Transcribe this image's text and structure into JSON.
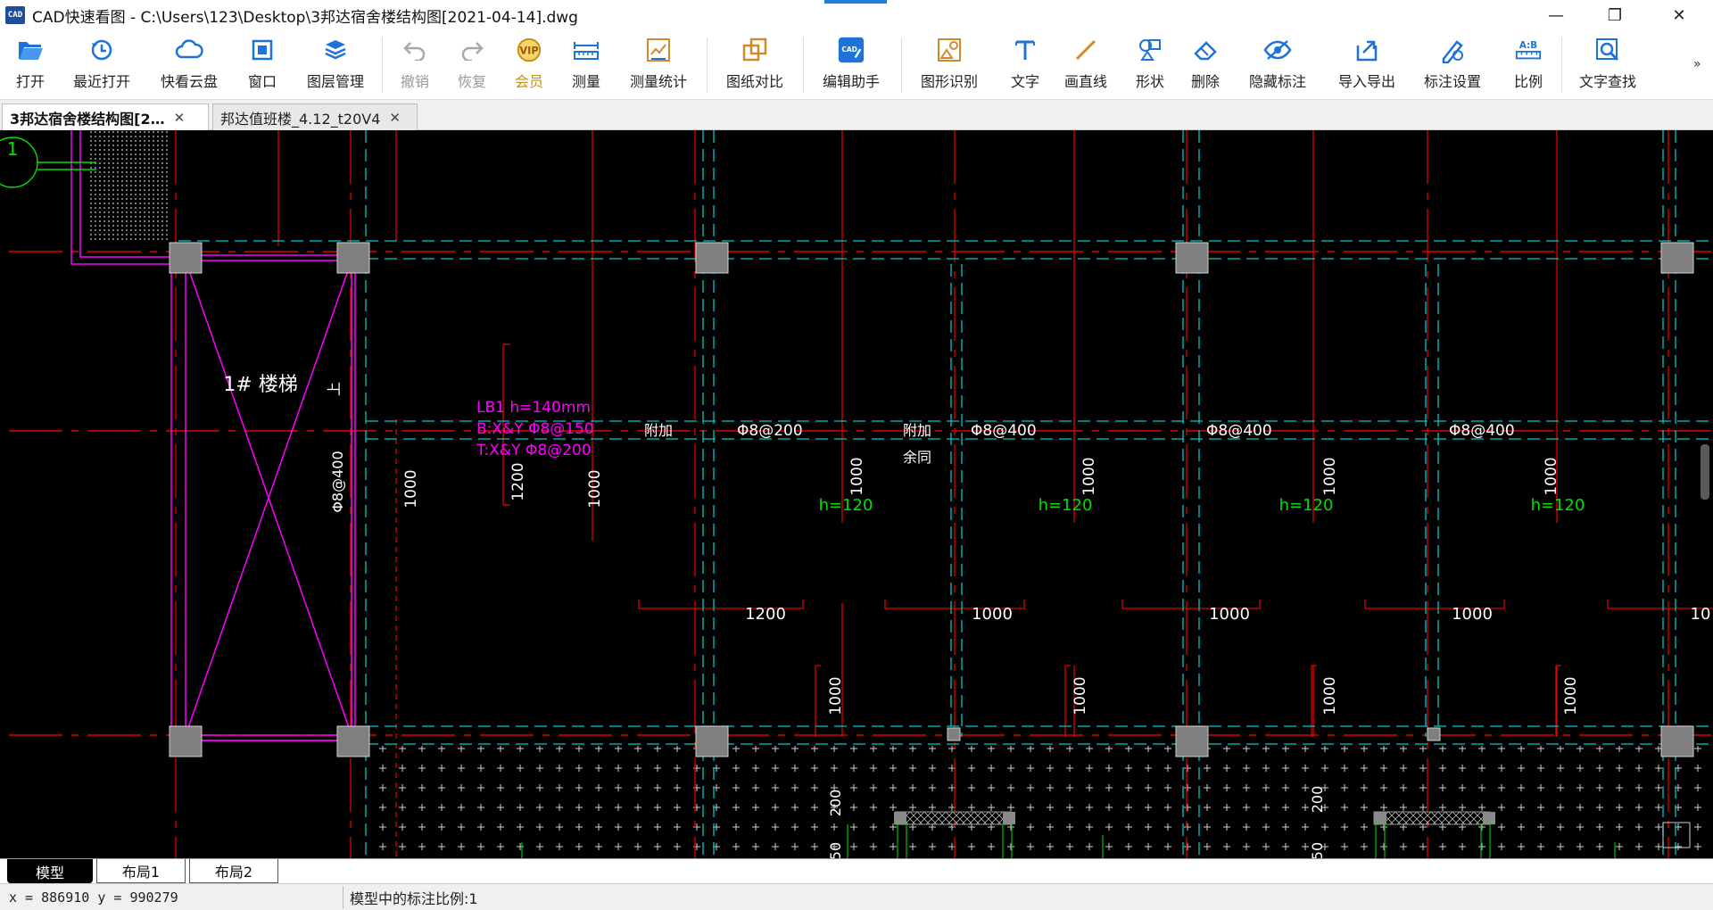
{
  "window": {
    "app_icon_text": "CAD",
    "title": "CAD快速看图 - C:\\Users\\123\\Desktop\\3邦达宿舍楼结构图[2021-04-14].dwg",
    "minimize": "—",
    "maximize": "❐",
    "close": "✕"
  },
  "toolbar": {
    "items": [
      {
        "label": "打开",
        "icon": "folder-open-icon",
        "color": "#1e73d8"
      },
      {
        "label": "最近打开",
        "icon": "recent-clock-icon",
        "color": "#1e73d8"
      },
      {
        "label": "快看云盘",
        "icon": "cloud-icon",
        "color": "#1e73d8"
      },
      {
        "label": "窗口",
        "icon": "window-icon",
        "color": "#1e73d8"
      },
      {
        "label": "图层管理",
        "icon": "layers-icon",
        "color": "#1e73d8"
      },
      {
        "label": "撤销",
        "icon": "undo-icon",
        "color": "#9a9a9a"
      },
      {
        "label": "恢复",
        "icon": "redo-icon",
        "color": "#9a9a9a"
      },
      {
        "label": "会员",
        "icon": "vip-icon",
        "color": "#d9a21b"
      },
      {
        "label": "测量",
        "icon": "ruler-icon",
        "color": "#1e73d8"
      },
      {
        "label": "测量统计",
        "icon": "measure-stats-icon",
        "color": "#d08a2a"
      },
      {
        "label": "图纸对比",
        "icon": "compare-icon",
        "color": "#d08a2a"
      },
      {
        "label": "编辑助手",
        "icon": "edit-assistant-icon",
        "color": "#1e73d8"
      },
      {
        "label": "图形识别",
        "icon": "shape-recognize-icon",
        "color": "#d08a2a"
      },
      {
        "label": "文字",
        "icon": "text-icon",
        "color": "#1e73d8"
      },
      {
        "label": "画直线",
        "icon": "line-icon",
        "color": "#d08a2a"
      },
      {
        "label": "形状",
        "icon": "shape-icon",
        "color": "#1e73d8"
      },
      {
        "label": "删除",
        "icon": "eraser-icon",
        "color": "#1e73d8"
      },
      {
        "label": "隐藏标注",
        "icon": "eye-hide-icon",
        "color": "#1e73d8"
      },
      {
        "label": "导入导出",
        "icon": "import-export-icon",
        "color": "#1e73d8"
      },
      {
        "label": "标注设置",
        "icon": "annotation-settings-icon",
        "color": "#1e73d8"
      },
      {
        "label": "比例",
        "icon": "scale-ratio-icon",
        "color": "#1e73d8"
      },
      {
        "label": "文字查找",
        "icon": "text-search-icon",
        "color": "#1e73d8"
      }
    ],
    "more": "»"
  },
  "doc_tabs": [
    {
      "label": "3邦达宿舍楼结构图[2…",
      "close": "✕",
      "active": true
    },
    {
      "label": "邦达值班楼_4.12_t20V4",
      "close": "✕",
      "active": false
    }
  ],
  "drawing": {
    "grid_bubble": "1",
    "stair_label": "1# 楼梯",
    "side_label": "上",
    "stair_rebar": "Φ8@400",
    "slab_annotation": [
      "LB1 h=140mm",
      "B:X&Y Φ8@150",
      "T:X&Y Φ8@200"
    ],
    "tag_fujia": "附加",
    "tag_fujia_jin": "附加",
    "tag_yuliu": "余同",
    "rebar_labels": [
      "Φ8@200",
      "Φ8@400",
      "Φ8@400",
      "Φ8@400"
    ],
    "thickness_labels": [
      "h=120",
      "h=120",
      "h=120",
      "h=120"
    ],
    "dim_horizontal": [
      "1200",
      "1000",
      "1000",
      "1000",
      "10"
    ],
    "dim_vertical_upper": [
      "1000",
      "1200",
      "1000",
      "1000",
      "1000",
      "1000",
      "1000"
    ],
    "dim_vertical_lower": [
      "1000",
      "1000",
      "1000",
      "1000"
    ],
    "dim_bottom": [
      "200",
      "50",
      "200",
      "50"
    ],
    "colors": {
      "background": "#000000",
      "axis_red": "#e00000",
      "beam_cyan": "#00c8c8",
      "stair_magenta": "#ff00ff",
      "text_white": "#ffffff",
      "text_green": "#00e000",
      "column_gray": "#7f7f7f"
    }
  },
  "layout_tabs": [
    "模型",
    "布局1",
    "布局2"
  ],
  "status": {
    "coords": "x = 886910  y = 990279",
    "scale": "模型中的标注比例:1"
  }
}
